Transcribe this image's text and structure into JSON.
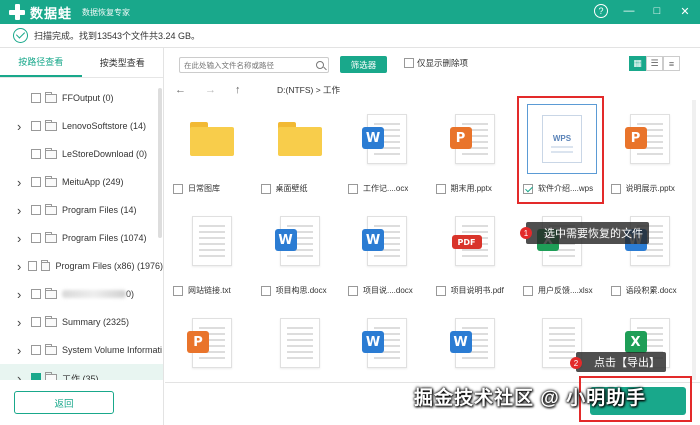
{
  "app": {
    "name": "数据蛙",
    "subtitle": "数据恢复专家",
    "window_buttons": [
      "?",
      "—",
      "□",
      "✕"
    ]
  },
  "status": {
    "text": "扫描完成。找到13543个文件共3.24 GB。"
  },
  "sidebar": {
    "tabs": [
      {
        "label": "按路径查看",
        "active": true
      },
      {
        "label": "按类型查看",
        "active": false
      }
    ],
    "tree": [
      {
        "label": "FFOutput (0)",
        "expandable": false
      },
      {
        "label": "LenovoSoftstore (14)",
        "expandable": true
      },
      {
        "label": "LeStoreDownload (0)",
        "expandable": false
      },
      {
        "label": "MeituApp (249)",
        "expandable": true
      },
      {
        "label": "Program Files (14)",
        "expandable": true
      },
      {
        "label": "Program Files (1074)",
        "expandable": true
      },
      {
        "label": "Program Files (x86) (1976)",
        "expandable": true
      },
      {
        "label": "",
        "expandable": true,
        "blurred": true,
        "suffix": "0)"
      },
      {
        "label": "Summary (2325)",
        "expandable": true
      },
      {
        "label": "System Volume Informati",
        "expandable": true
      },
      {
        "label": "工作 (35)",
        "expandable": true,
        "selected": true
      }
    ],
    "back_label": "返回"
  },
  "toolbar": {
    "search_placeholder": "在此处输入文件名称或路径",
    "filter_label": "筛选器",
    "show_deleted_label": "仅显示删除项",
    "views": [
      "grid",
      "list",
      "detail"
    ]
  },
  "pathbar": {
    "back": "←",
    "forward": "→",
    "up": "↑",
    "path": "D:(NTFS) > 工作"
  },
  "files": [
    {
      "name": "日常图库",
      "type": "folder",
      "checked": false
    },
    {
      "name": "桌面壁纸",
      "type": "folder",
      "checked": false
    },
    {
      "name": "工作记....ocx",
      "type": "word",
      "checked": false
    },
    {
      "name": "期末用.pptx",
      "type": "ppt",
      "checked": false
    },
    {
      "name": "软件介绍....wps",
      "type": "wps",
      "checked": true
    },
    {
      "name": "说明展示.pptx",
      "type": "ppt",
      "checked": false
    },
    {
      "name": "网站链接.txt",
      "type": "txt",
      "checked": false
    },
    {
      "name": "项目构思.docx",
      "type": "word",
      "checked": false
    },
    {
      "name": "项目说....docx",
      "type": "word",
      "checked": false
    },
    {
      "name": "项目说明书.pdf",
      "type": "pdf",
      "checked": false
    },
    {
      "name": "用户反馈....xlsx",
      "type": "excel",
      "checked": false
    },
    {
      "name": "语段积累.docx",
      "type": "word",
      "checked": false
    },
    {
      "name": "",
      "type": "ppt",
      "checked": false
    },
    {
      "name": "",
      "type": "txt",
      "checked": false
    },
    {
      "name": "",
      "type": "word",
      "checked": false
    },
    {
      "name": "",
      "type": "word",
      "checked": false
    },
    {
      "name": "",
      "type": "txt",
      "checked": false
    },
    {
      "name": "",
      "type": "excel",
      "checked": false
    }
  ],
  "annotations": {
    "step1_num": "1",
    "step1_text": "选中需要恢复的文件",
    "step2_num": "2",
    "step2_text": "点击【导出】",
    "accent": "#e32a2a"
  },
  "watermark": "掘金技术社区 @ 小明助手",
  "colors": {
    "brand": "#19a88b",
    "word": "#2b7cd3",
    "ppt": "#e9742b",
    "pdf": "#d9342b",
    "excel": "#1e9e57",
    "folder": "#f8cd4b"
  }
}
